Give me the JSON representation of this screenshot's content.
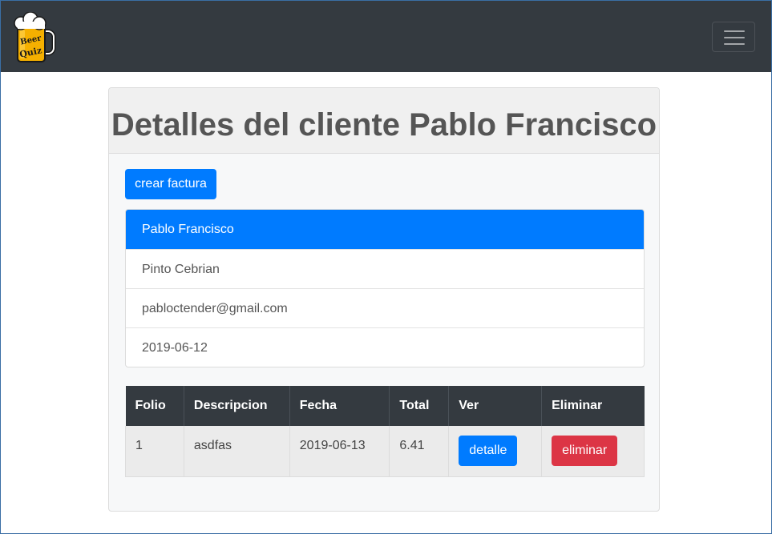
{
  "navbar": {
    "logo_alt": "Beer Quiz",
    "toggle_icon": "hamburger-icon"
  },
  "card": {
    "title": "Detalles del cliente Pablo Francisco",
    "create_button": "crear factura"
  },
  "client": {
    "name": "Pablo Francisco",
    "surname": "Pinto Cebrian",
    "email": "pabloctender@gmail.com",
    "date": "2019-06-12"
  },
  "invoices": {
    "headers": [
      "Folio",
      "Descripcion",
      "Fecha",
      "Total",
      "Ver",
      "Eliminar"
    ],
    "rows": [
      {
        "folio": "1",
        "descripcion": "asdfas",
        "fecha": "2019-06-13",
        "total": "6.41",
        "ver_label": "detalle",
        "eliminar_label": "eliminar"
      }
    ]
  },
  "colors": {
    "navbar": "#343a40",
    "primary": "#007bff",
    "danger": "#dc3545"
  }
}
